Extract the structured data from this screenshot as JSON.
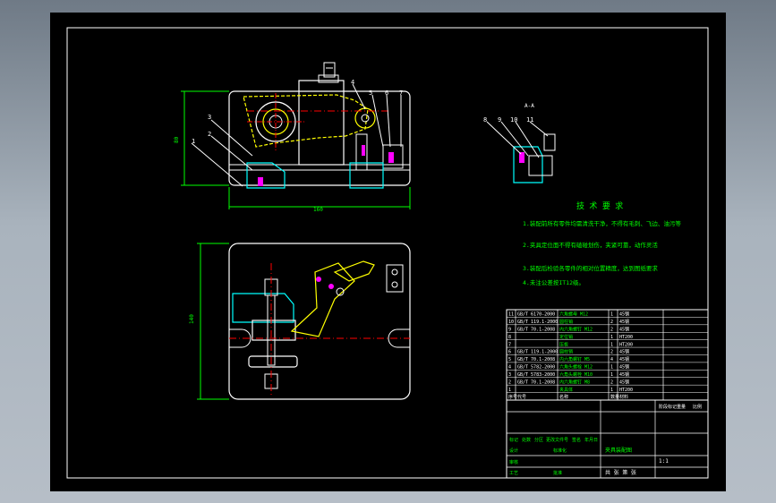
{
  "colors": {
    "background_top": "#6f7a86",
    "background_bottom": "#b6bec7",
    "paper": "#000000",
    "outline": "#ffffff",
    "dimension": "#00ff00",
    "link_arm": "#ffff00",
    "fastener": "#ff00ff",
    "section_hatch": "#00ffff",
    "center_line": "#ff0000"
  },
  "front_view": {
    "callouts": [
      "1",
      "2",
      "3",
      "4",
      "5",
      "6",
      "7"
    ],
    "dim_width": "160",
    "dim_height": "80"
  },
  "top_view": {
    "dim_height": "140"
  },
  "section_view": {
    "title": "A-A",
    "callouts": [
      "8",
      "9",
      "10",
      "11"
    ]
  },
  "tech_req": {
    "title": "技 术 要 求",
    "lines": [
      "1.装配前所有零件均需清洗干净，不得有毛刺、飞边、油污等",
      "2.夹具定位面不得有磕碰划伤，夹紧可靠，动作灵活",
      "3.装配后检验各零件的相对位置精度，达到图纸要求",
      "4.未注公差按IT12级。"
    ]
  },
  "bom": {
    "rows": [
      {
        "no": "11",
        "code": "GB/T 6170-2000",
        "name": "六角螺母 M12",
        "qty": "1",
        "mat": "45钢"
      },
      {
        "no": "10",
        "code": "GB/T 119.1-2000",
        "name": "圆柱销",
        "qty": "2",
        "mat": "45钢"
      },
      {
        "no": "9",
        "code": "GB/T 70.1-2008",
        "name": "内六角螺钉 M12",
        "qty": "2",
        "mat": "45钢"
      },
      {
        "no": "8",
        "code": "",
        "name": "定位销",
        "qty": "1",
        "mat": "HT200"
      },
      {
        "no": "7",
        "code": "",
        "name": "压板",
        "qty": "1",
        "mat": "HT200"
      },
      {
        "no": "6",
        "code": "GB/T 119.1-2000",
        "name": "圆柱销",
        "qty": "2",
        "mat": "45钢"
      },
      {
        "no": "5",
        "code": "GB/T 70.1-2008",
        "name": "内六角螺钉 M5",
        "qty": "4",
        "mat": "45钢"
      },
      {
        "no": "4",
        "code": "GB/T 5782-2000",
        "name": "六角头螺栓 M12",
        "qty": "1",
        "mat": "45钢"
      },
      {
        "no": "3",
        "code": "GB/T 5783-2000",
        "name": "六角头螺栓 M10",
        "qty": "1",
        "mat": "45钢"
      },
      {
        "no": "2",
        "code": "GB/T 70.1-2008",
        "name": "内六角螺钉 M8",
        "qty": "2",
        "mat": "45钢"
      },
      {
        "no": "1",
        "code": "",
        "name": "夹具体",
        "qty": "1",
        "mat": "HT200"
      }
    ],
    "header": [
      "序号",
      "代号",
      "名称",
      "数量",
      "材料"
    ]
  },
  "title_block": {
    "drawing_name": "夹具装配图",
    "scale": "1:1",
    "sheet": "共 张 第 张",
    "labels": [
      "标记",
      "处数",
      "分区",
      "更改文件号",
      "签名",
      "年月日",
      "设计",
      "标准化",
      "审核",
      "工艺",
      "批准",
      "阶段标记",
      "重量",
      "比例"
    ]
  }
}
